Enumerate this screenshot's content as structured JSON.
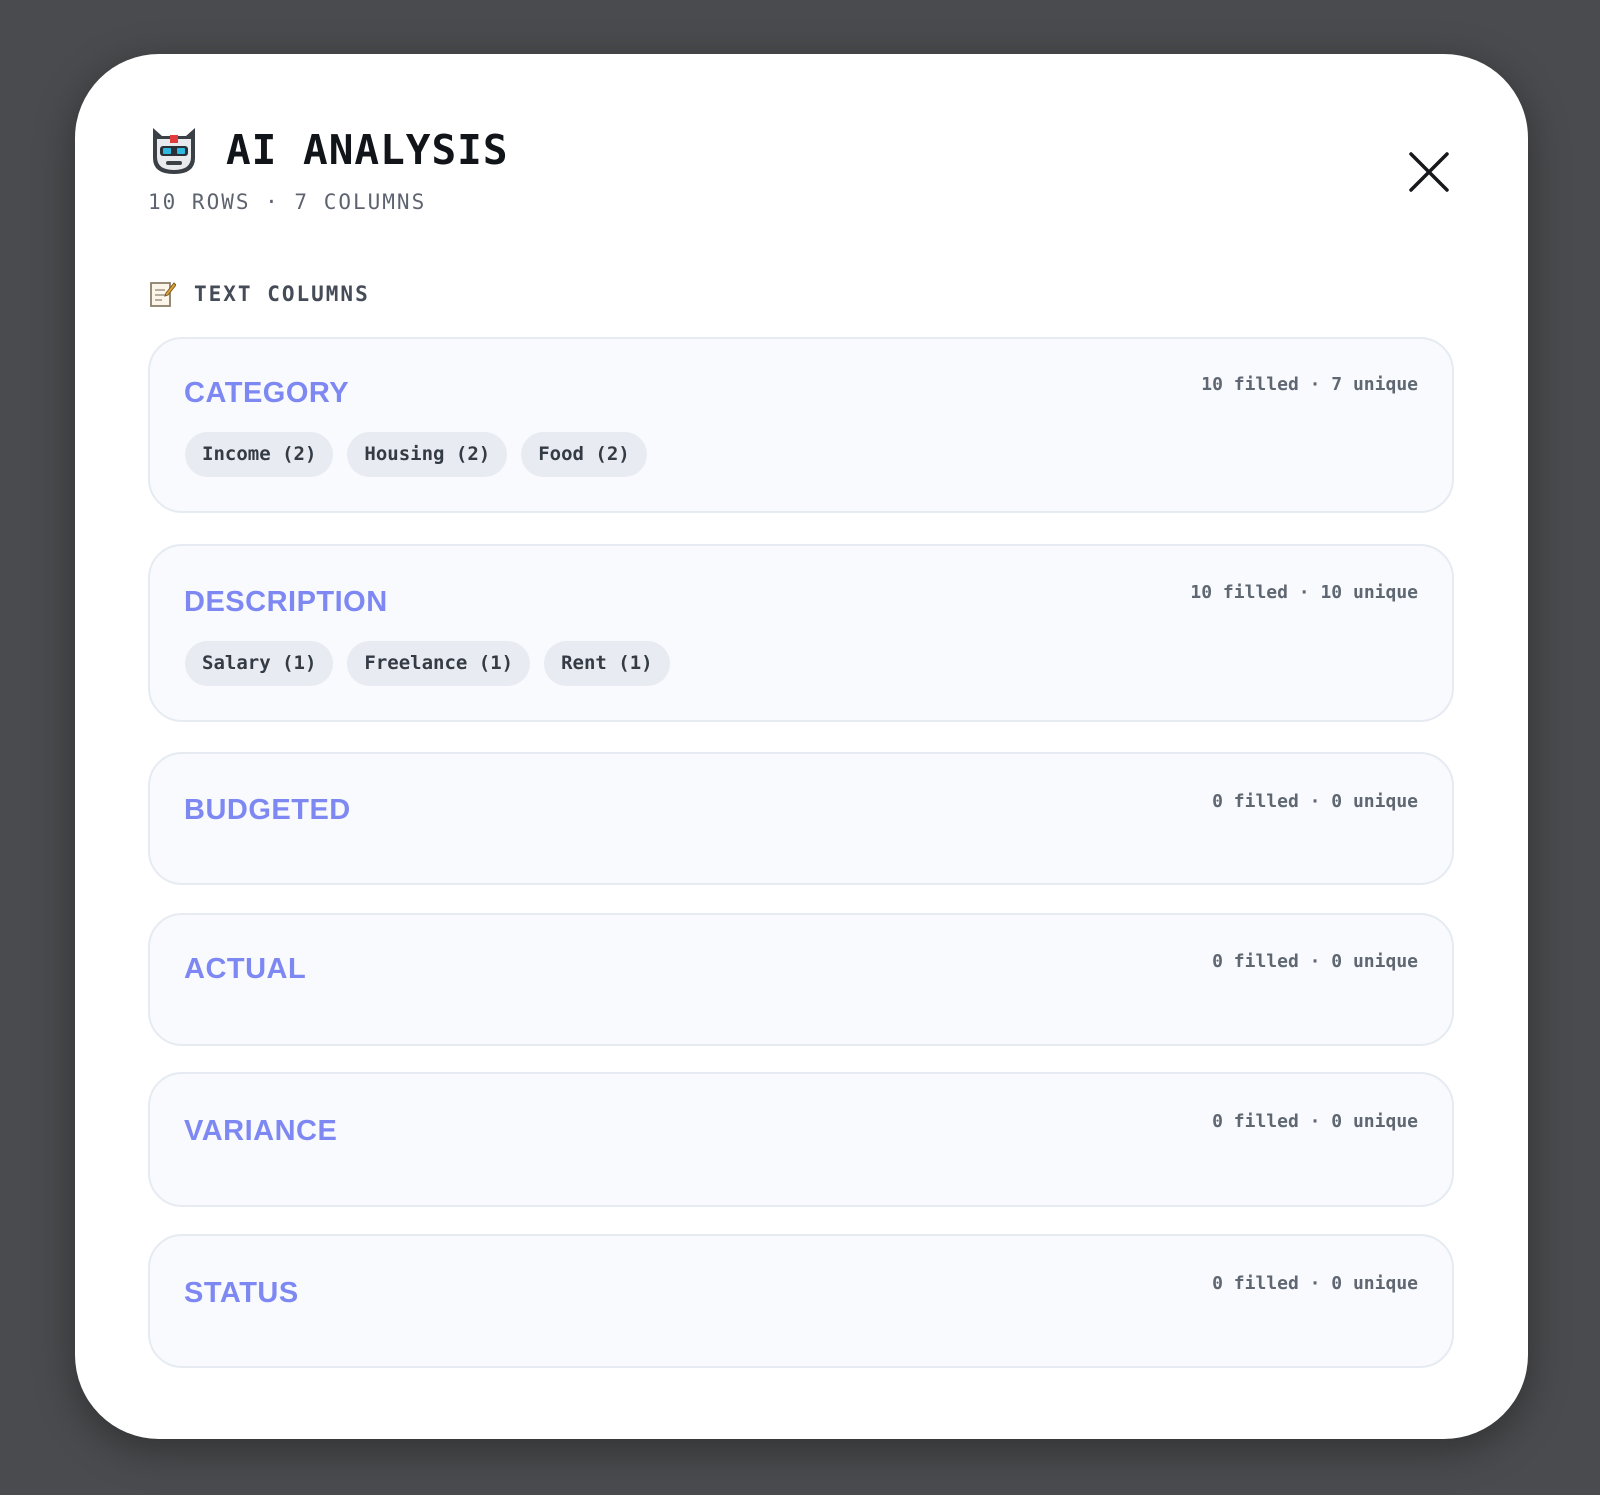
{
  "modal": {
    "title": "AI ANALYSIS",
    "subtitle": "10 ROWS · 7 COLUMNS",
    "title_icon": "robot-icon",
    "close_icon": "close-icon"
  },
  "section": {
    "icon": "memo-icon",
    "label": "TEXT COLUMNS"
  },
  "columns": [
    {
      "name": "CATEGORY",
      "stats": "10 filled · 7 unique",
      "values": [
        "Income (2)",
        "Housing (2)",
        "Food (2)"
      ]
    },
    {
      "name": "DESCRIPTION",
      "stats": "10 filled · 10 unique",
      "values": [
        "Salary (1)",
        "Freelance (1)",
        "Rent (1)"
      ]
    },
    {
      "name": "BUDGETED",
      "stats": "0 filled · 0 unique",
      "values": []
    },
    {
      "name": "ACTUAL",
      "stats": "0 filled · 0 unique",
      "values": []
    },
    {
      "name": "VARIANCE",
      "stats": "0 filled · 0 unique",
      "values": []
    },
    {
      "name": "STATUS",
      "stats": "0 filled · 0 unique",
      "values": []
    }
  ],
  "colors": {
    "column_name": "#7e88f2",
    "backdrop": "#4a4b4e"
  }
}
